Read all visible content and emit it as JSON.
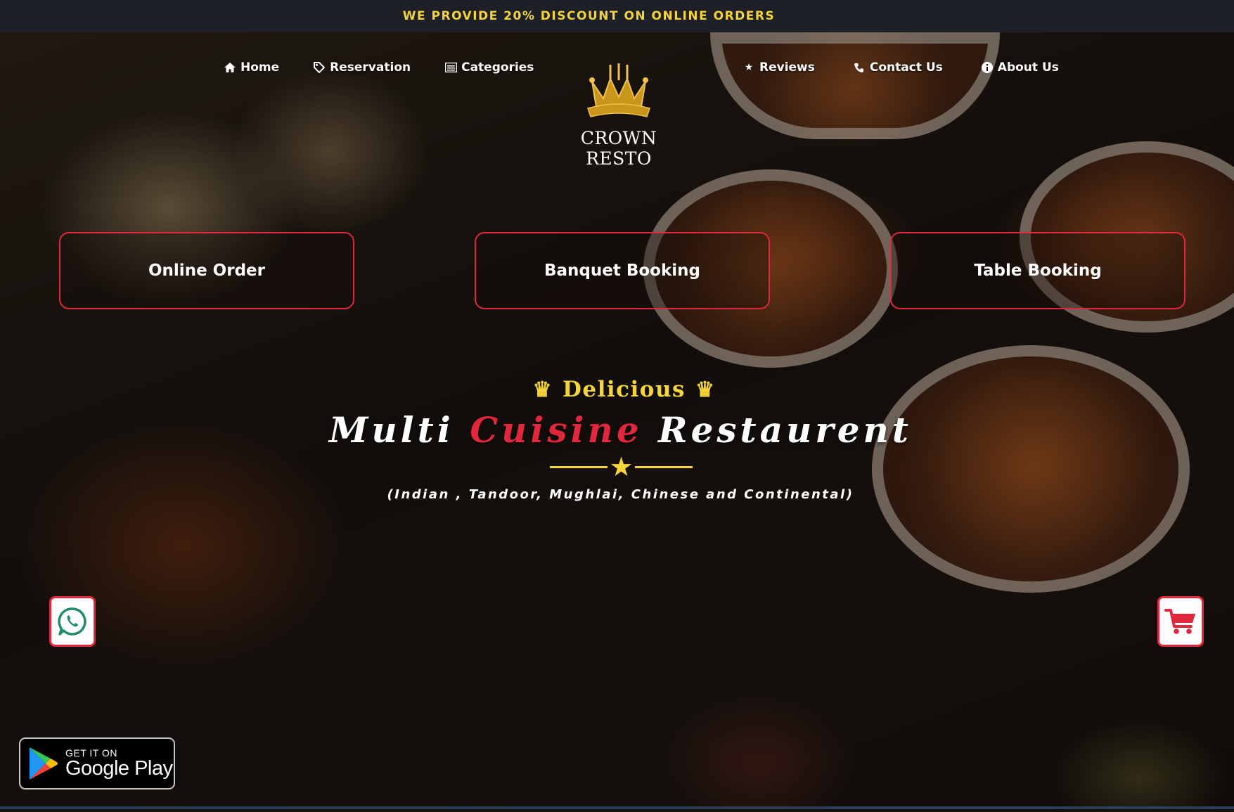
{
  "promo": {
    "text": "WE PROVIDE 20% DISCOUNT ON ONLINE ORDERS"
  },
  "nav": {
    "left": [
      {
        "label": "Home",
        "icon": "home-icon"
      },
      {
        "label": "Reservation",
        "icon": "tag-icon"
      },
      {
        "label": "Categories",
        "icon": "list-icon"
      }
    ],
    "right": [
      {
        "label": "Reviews",
        "icon": "star-icon"
      },
      {
        "label": "Contact Us",
        "icon": "phone-icon"
      },
      {
        "label": "About Us",
        "icon": "info-icon"
      }
    ]
  },
  "logo": {
    "name": "CROWN RESTO",
    "emblem_text": "CROWN RESTO"
  },
  "booking": {
    "online_order": "Online Order",
    "banquet_booking": "Banquet Booking",
    "table_booking": "Table Booking"
  },
  "hero": {
    "tagline_icon": "♛",
    "tagline": "Delicious",
    "title_part1": "Multi ",
    "title_accent": "Cuisine",
    "title_part2": " Restaurent",
    "divider_icon": "★",
    "cuisines": "(Indian , Tandoor, Mughlai, Chinese and Continental)"
  },
  "floating": {
    "whatsapp_icon": "whatsapp-icon",
    "cart_icon": "cart-icon"
  },
  "app_badge": {
    "small_text": "GET IT ON",
    "store_name": "Google Play"
  },
  "colors": {
    "accent_red": "#e0273b",
    "gold": "#f5d33a",
    "promo_bg": "#1e2028",
    "text": "#ffffff"
  }
}
